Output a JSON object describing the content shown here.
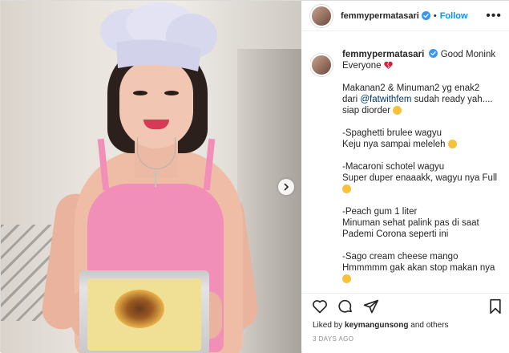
{
  "post": {
    "username": "femmypermatasari",
    "header_separator": "•",
    "follow_label": "Follow",
    "more_label": "•••",
    "caption_greeting": "Good Monink Everyone",
    "caption_lines": [
      {
        "text": "Makanan2 & Minuman2 yg enak2"
      },
      {
        "prefix": "dari ",
        "mention": "@fatwithfem",
        "suffix": " sudah ready yah.... siap diorder"
      },
      {
        "text": "-Spaghetti brulee wagyu"
      },
      {
        "text": "Keju nya sampai meleleh"
      },
      {
        "text": "-Macaroni schotel wagyu"
      },
      {
        "text": "Super duper enaaakk, wagyu nya Full"
      },
      {
        "text": "-Peach gum 1 liter"
      },
      {
        "text": "Minuman sehat palink pas di saat Pademi Corona seperti ini"
      },
      {
        "text": "-Sago cream cheese mango"
      },
      {
        "text": "Hmmmmm gak akan stop makan nya"
      }
    ],
    "liked_by_prefix": "Liked by",
    "liked_by_user": "keymangunsong",
    "liked_by_suffix": "and others",
    "time_ago": "3 DAYS AGO"
  },
  "icons": [
    "verified-badge-icon",
    "heart-icon",
    "comment-icon",
    "share-icon",
    "bookmark-icon",
    "chevron-right-icon"
  ],
  "colors": {
    "accent": "#0095f6",
    "verified": "#3897f0",
    "text": "#262626",
    "muted": "#8e8e8e",
    "mention": "#00376b"
  }
}
